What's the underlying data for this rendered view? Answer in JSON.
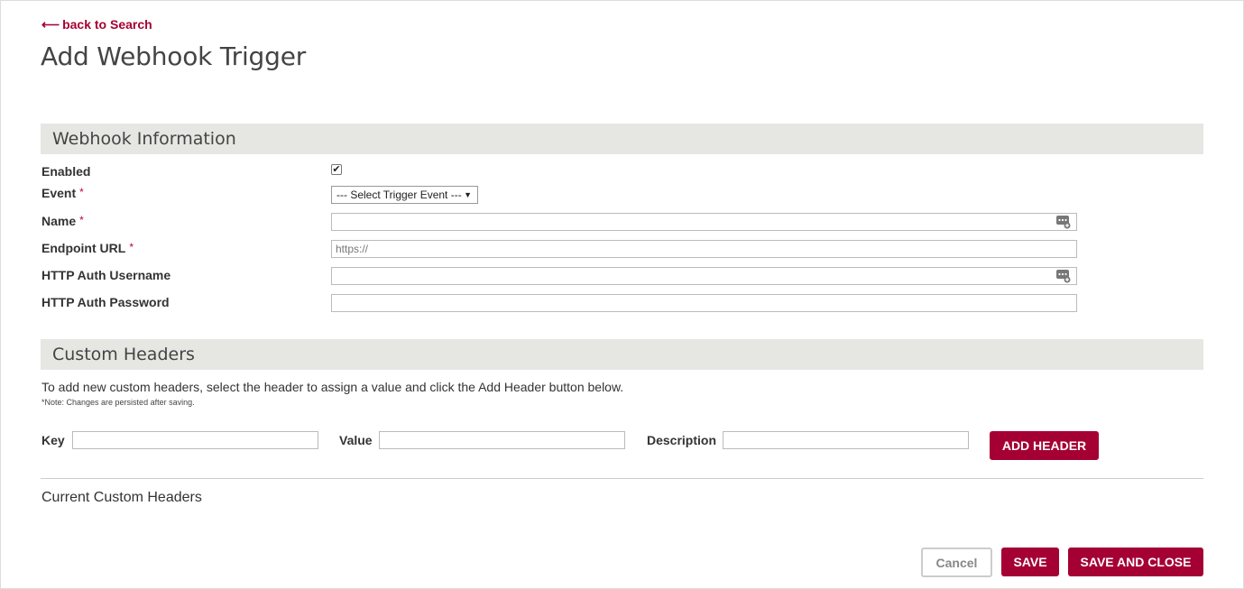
{
  "nav": {
    "back_arrow": "⟵",
    "back_label": "back to Search"
  },
  "page": {
    "title": "Add Webhook Trigger"
  },
  "webhook_info": {
    "section_title": "Webhook Information",
    "required_mark": "*",
    "enabled_label": "Enabled",
    "enabled_checked": true,
    "event_label": "Event",
    "event_selected": "--- Select Trigger Event ---",
    "name_label": "Name",
    "name_value": "",
    "endpoint_label": "Endpoint URL",
    "endpoint_placeholder": "https://",
    "username_label": "HTTP Auth Username",
    "username_value": "",
    "password_label": "HTTP Auth Password",
    "password_value": ""
  },
  "custom_headers": {
    "section_title": "Custom Headers",
    "description": "To add new custom headers, select the header to assign a value and click the Add Header button below.",
    "note": "*Note: Changes are persisted after saving.",
    "key_label": "Key",
    "value_label": "Value",
    "description_label": "Description",
    "add_button": "ADD HEADER",
    "current_title": "Current Custom Headers"
  },
  "footer": {
    "cancel": "Cancel",
    "save": "SAVE",
    "save_close": "SAVE AND CLOSE"
  },
  "colors": {
    "accent": "#a50034",
    "section_bg": "#e6e6e3"
  }
}
